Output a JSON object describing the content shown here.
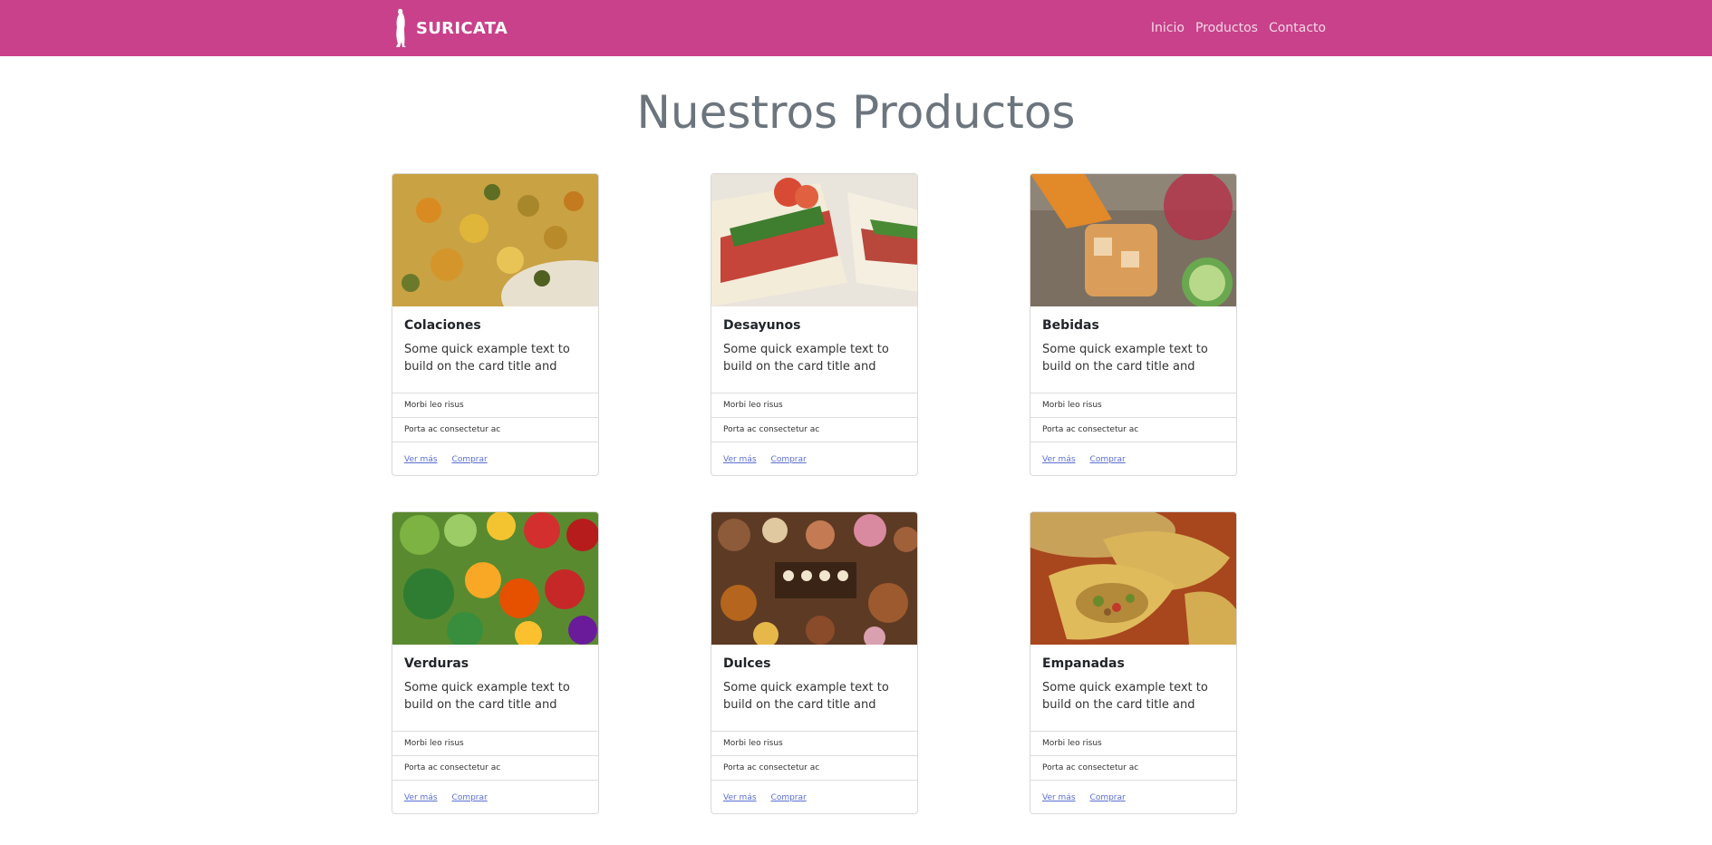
{
  "brand": {
    "name": "SURICATA",
    "logo": "meerkat-logo-icon"
  },
  "nav": {
    "items": [
      "Inicio",
      "Productos",
      "Contacto"
    ]
  },
  "page": {
    "title": "Nuestros Productos"
  },
  "colors": {
    "navbar": "#c8418a",
    "title": "#6c757d",
    "link": "#5a6fd1"
  },
  "cards": [
    {
      "title": "Colaciones",
      "text": "Some quick example text to build on the card title and",
      "items": [
        "Morbi leo risus",
        "Porta ac consectetur ac"
      ],
      "links": [
        "Ver más",
        "Comprar"
      ],
      "image": "curry-dish-photo"
    },
    {
      "title": "Desayunos",
      "text": "Some quick example text to build on the card title and",
      "items": [
        "Morbi leo risus",
        "Porta ac consectetur ac"
      ],
      "links": [
        "Ver más",
        "Comprar"
      ],
      "image": "sandwich-photo"
    },
    {
      "title": "Bebidas",
      "text": "Some quick example text to build on the card title and",
      "items": [
        "Morbi leo risus",
        "Porta ac consectetur ac"
      ],
      "links": [
        "Ver más",
        "Comprar"
      ],
      "image": "iced-drinks-photo"
    },
    {
      "title": "Verduras",
      "text": "Some quick example text to build on the card title and",
      "items": [
        "Morbi leo risus",
        "Porta ac consectetur ac"
      ],
      "links": [
        "Ver más",
        "Comprar"
      ],
      "image": "vegetables-photo"
    },
    {
      "title": "Dulces",
      "text": "Some quick example text to build on the card title and",
      "items": [
        "Morbi leo risus",
        "Porta ac consectetur ac"
      ],
      "links": [
        "Ver más",
        "Comprar"
      ],
      "image": "sweets-photo"
    },
    {
      "title": "Empanadas",
      "text": "Some quick example text to build on the card title and",
      "items": [
        "Morbi leo risus",
        "Porta ac consectetur ac"
      ],
      "links": [
        "Ver más",
        "Comprar"
      ],
      "image": "empanadas-photo"
    }
  ]
}
